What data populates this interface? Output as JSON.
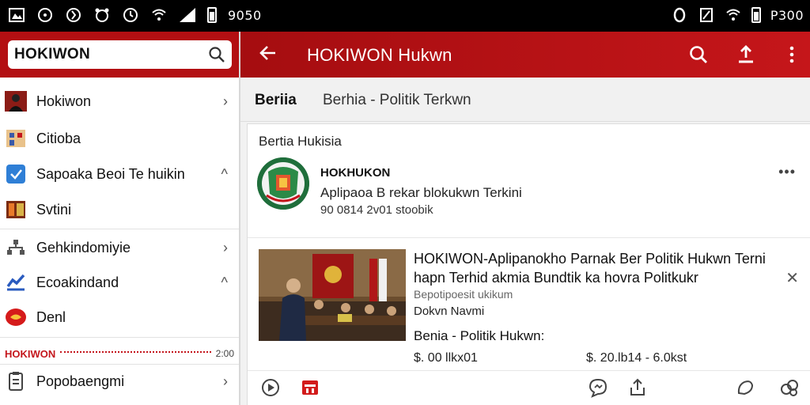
{
  "status_bar": {
    "time_left": "9050",
    "time_right": "P300"
  },
  "search": {
    "value": "HOKIWON"
  },
  "menu": [
    {
      "label": "Hokiwon",
      "chevron": "›"
    },
    {
      "label": "Citioba",
      "chevron": ""
    },
    {
      "label": "Sapoaka Beoi Te huikin",
      "chevron": "^"
    },
    {
      "label": "Svtini",
      "chevron": ""
    },
    {
      "label": "Gehkindomiyie",
      "chevron": "›"
    },
    {
      "label": "Ecoakindand",
      "chevron": "^"
    },
    {
      "label": "Denl",
      "chevron": ""
    },
    {
      "label": "Popobaengmi",
      "chevron": "›"
    }
  ],
  "section": {
    "label": "HOKIWON",
    "right": "2:00"
  },
  "appbar": {
    "back_icon": "arrow-left-icon",
    "title": "HOKIWON Hukwn"
  },
  "tabs": {
    "active": "Beriia",
    "path": "Berhia  -  Politik Terkwn"
  },
  "card": {
    "title": "Bertia Hukisia",
    "publisher": {
      "name": "HOKHUKON",
      "desc": "Aplipaoa B rekar blokukwn Terkini",
      "time": "90 0814 2v01 stoobik"
    },
    "more": "•••",
    "article": {
      "title": "HOKIWON-Aplipanokho Parnak Ber Politik Hukwn Terni hapn Terhid akmia Bundtik ka hovra Politkukr",
      "subtitle": "Bepotipoesit ukikum",
      "source": "Dokvn Navmi",
      "close": "✕",
      "category": "Benia - Politik Hukwn:",
      "price_left": "$. 00 llkx01",
      "price_right": "$. 20.lb14 - 6.0kst"
    }
  },
  "colors": {
    "brand_red": "#b30f12",
    "status_bg": "#000000"
  }
}
